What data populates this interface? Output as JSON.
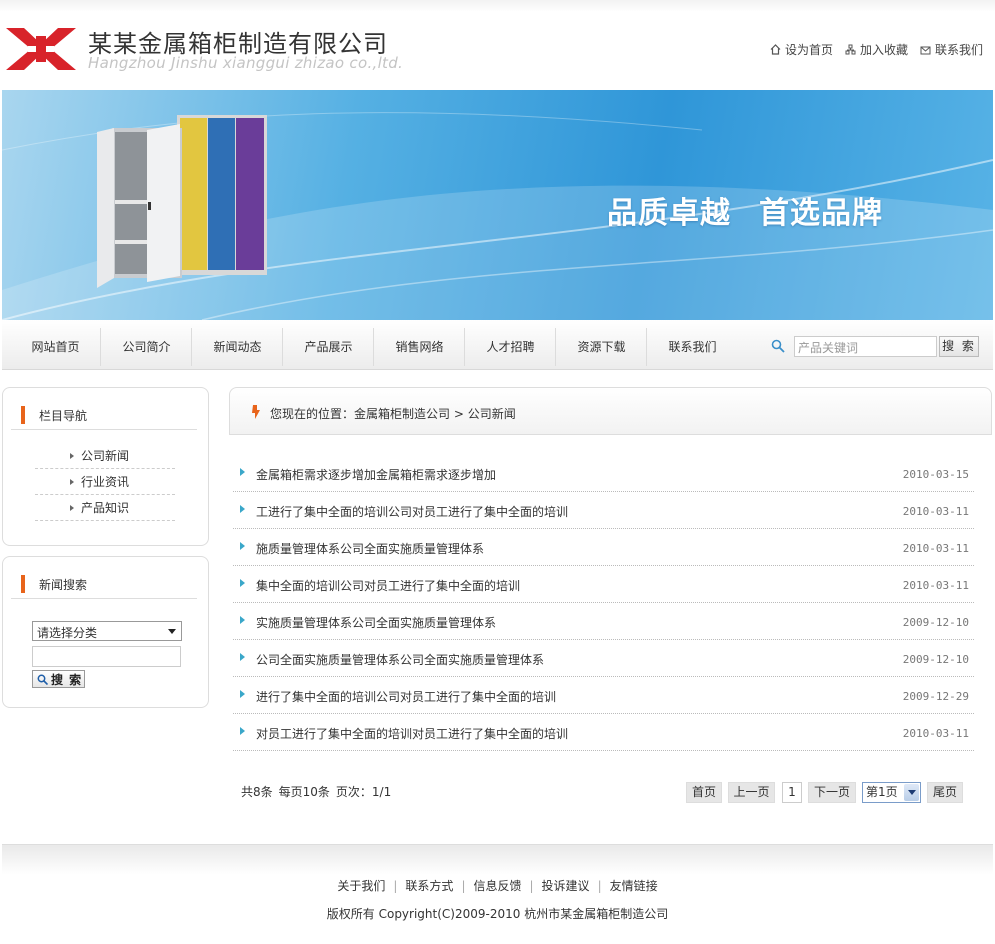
{
  "header": {
    "company_cn": "某某金属箱柜制造有限公司",
    "company_en": "Hangzhou Jinshu xianggui zhizao co.,ltd.",
    "links": [
      "设为首页",
      "加入收藏",
      "联系我们"
    ],
    "logo_color": "#d8232a"
  },
  "banner": {
    "slogan_1": "品质卓越",
    "slogan_2": "首选品牌"
  },
  "nav": {
    "items": [
      "网站首页",
      "公司简介",
      "新闻动态",
      "产品展示",
      "销售网络",
      "人才招聘",
      "资源下载",
      "联系我们"
    ],
    "search_placeholder": "产品关键词",
    "search_button": "搜 索"
  },
  "sidebar": {
    "nav_title": "栏目导航",
    "categories": [
      "公司新闻",
      "行业资讯",
      "产品知识"
    ],
    "search_title": "新闻搜索",
    "select_value": "请选择分类",
    "search_button": "搜 索"
  },
  "main": {
    "breadcrumb_prefix": "您现在的位置：",
    "breadcrumb_home": "金属箱柜制造公司",
    "breadcrumb_sep": " > ",
    "breadcrumb_current": "公司新闻",
    "news": [
      {
        "title": "金属箱柜需求逐步增加金属箱柜需求逐步增加",
        "date": "2010-03-15"
      },
      {
        "title": "工进行了集中全面的培训公司对员工进行了集中全面的培训",
        "date": "2010-03-11"
      },
      {
        "title": "施质量管理体系公司全面实施质量管理体系",
        "date": "2010-03-11"
      },
      {
        "title": "集中全面的培训公司对员工进行了集中全面的培训",
        "date": "2010-03-11"
      },
      {
        "title": "实施质量管理体系公司全面实施质量管理体系",
        "date": "2009-12-10"
      },
      {
        "title": "公司全面实施质量管理体系公司全面实施质量管理体系",
        "date": "2009-12-10"
      },
      {
        "title": "进行了集中全面的培训公司对员工进行了集中全面的培训",
        "date": "2009-12-29"
      },
      {
        "title": "对员工进行了集中全面的培训对员工进行了集中全面的培训",
        "date": "2010-03-11"
      }
    ],
    "pager": {
      "total": "共8条",
      "per_page": "每页10条",
      "pages": "页次：1/1",
      "first": "首页",
      "prev": "上一页",
      "current": "1",
      "next": "下一页",
      "select": "第1页",
      "last": "尾页"
    }
  },
  "footer": {
    "links": [
      "关于我们",
      "联系方式",
      "信息反馈",
      "投诉建议",
      "友情链接"
    ],
    "copyright": "版权所有  Copyright(C)2009-2010 杭州市某金属箱柜制造公司"
  }
}
